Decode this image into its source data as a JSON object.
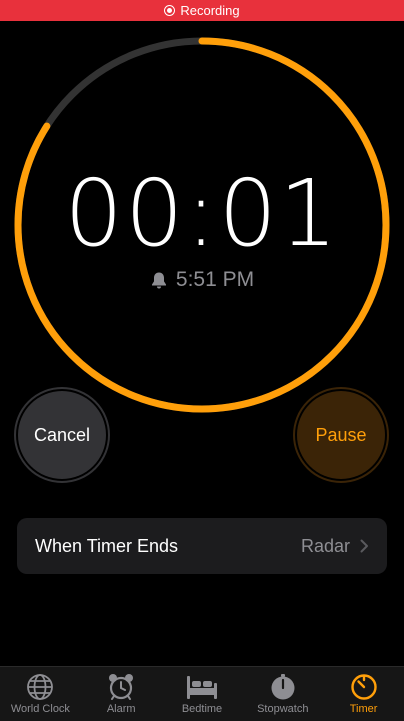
{
  "status_bar": {
    "recording_label": "Recording",
    "color": "#e8313c"
  },
  "timer": {
    "display": "00:01",
    "end_time": "5:51 PM",
    "progress_remaining": 0.84,
    "ring_color": "#ff9f0a",
    "track_color": "#333333"
  },
  "buttons": {
    "cancel_label": "Cancel",
    "pause_label": "Pause"
  },
  "settings": {
    "when_timer_ends_label": "When Timer Ends",
    "when_timer_ends_value": "Radar"
  },
  "tabs": [
    {
      "label": "World Clock",
      "icon": "globe-icon",
      "active": false
    },
    {
      "label": "Alarm",
      "icon": "alarm-clock-icon",
      "active": false
    },
    {
      "label": "Bedtime",
      "icon": "bed-icon",
      "active": false
    },
    {
      "label": "Stopwatch",
      "icon": "stopwatch-icon",
      "active": false
    },
    {
      "label": "Timer",
      "icon": "timer-icon",
      "active": true
    }
  ]
}
